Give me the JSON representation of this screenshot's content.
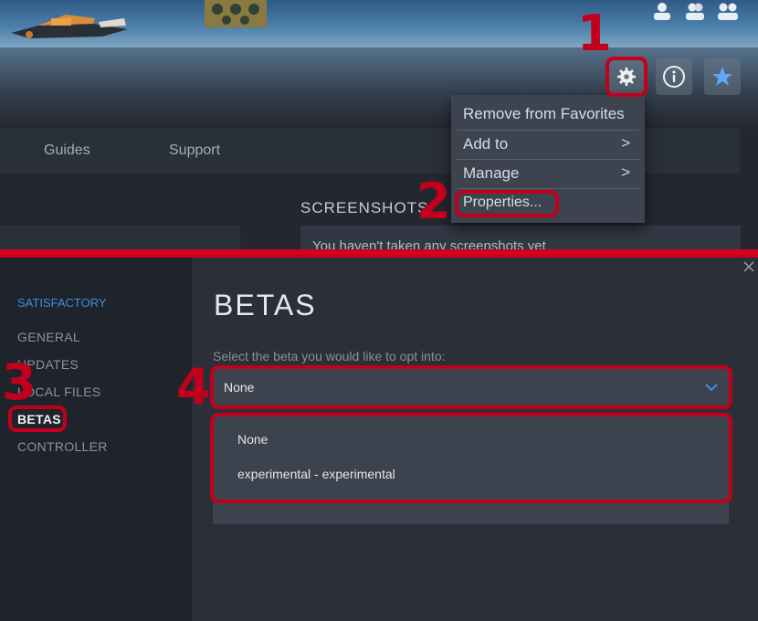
{
  "library": {
    "tabs": [
      "Guides",
      "Support"
    ],
    "section_title": "SCREENSHOTS",
    "screenshots_empty": "You haven't taken any screenshots yet"
  },
  "actions": {
    "settings_icon": "gear-icon",
    "info_icon": "info-icon",
    "favorite_icon": "star-icon"
  },
  "context_menu": {
    "remove_favorites": "Remove from Favorites",
    "add_to": "Add to",
    "manage": "Manage",
    "properties": "Properties...",
    "chevron": ">"
  },
  "properties": {
    "game_name": "SATISFACTORY",
    "nav": [
      "GENERAL",
      "UPDATES",
      "LOCAL FILES",
      "BETAS",
      "CONTROLLER"
    ],
    "page_title": "BETAS",
    "beta_label": "Select the beta you would like to opt into:",
    "selected": "None",
    "options": [
      "None",
      "experimental - experimental"
    ]
  },
  "annotations": {
    "step1": "1",
    "step2": "2",
    "step3": "3",
    "step4": "4",
    "color": "#c2001b"
  },
  "colors": {
    "accent": "#3d8fe3",
    "favorite_star": "#5fa8f5",
    "divider": "#d1001c"
  }
}
